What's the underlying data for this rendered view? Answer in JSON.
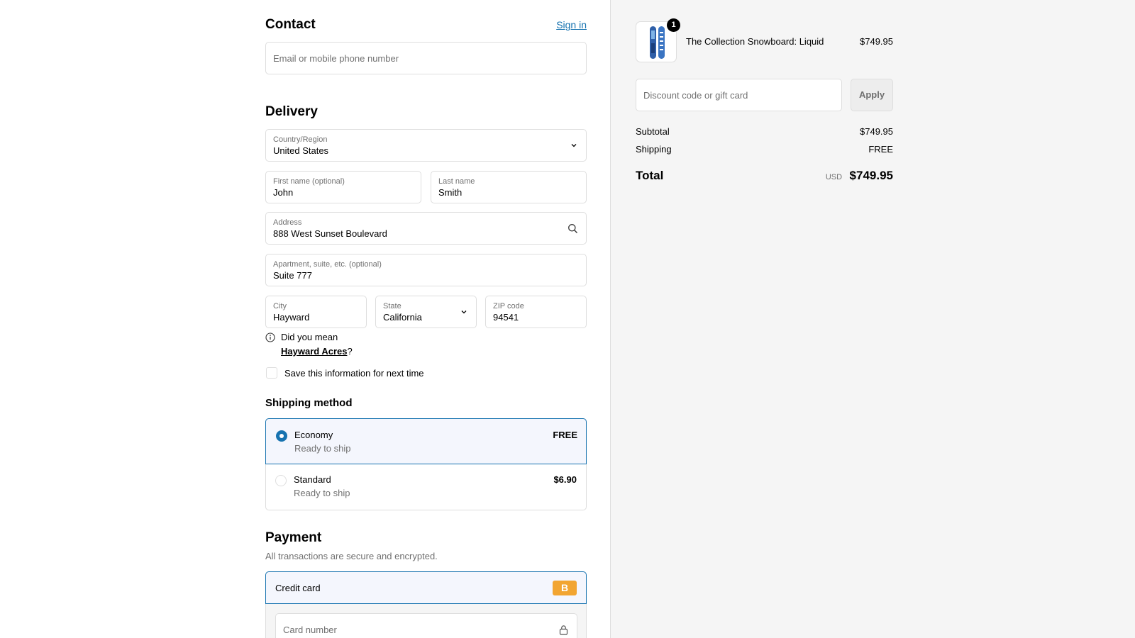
{
  "contact": {
    "title": "Contact",
    "sign_in": "Sign in",
    "email_placeholder": "Email or mobile phone number"
  },
  "delivery": {
    "title": "Delivery",
    "country_label": "Country/Region",
    "country_value": "United States",
    "first_name_label": "First name (optional)",
    "first_name_value": "John",
    "last_name_label": "Last name",
    "last_name_value": "Smith",
    "address_label": "Address",
    "address_value": "888 West Sunset Boulevard",
    "apt_label": "Apartment, suite, etc. (optional)",
    "apt_value": "Suite 777",
    "city_label": "City",
    "city_value": "Hayward",
    "state_label": "State",
    "state_value": "California",
    "zip_label": "ZIP code",
    "zip_value": "94541",
    "suggest_prefix": "Did you mean",
    "suggest_link": "Hayward Acres",
    "suggest_suffix": "?",
    "save_info": "Save this information for next time"
  },
  "shipping": {
    "title": "Shipping method",
    "options": [
      {
        "name": "Economy",
        "sub": "Ready to ship",
        "price": "FREE",
        "selected": true
      },
      {
        "name": "Standard",
        "sub": "Ready to ship",
        "price": "$6.90",
        "selected": false
      }
    ]
  },
  "payment": {
    "title": "Payment",
    "subtitle": "All transactions are secure and encrypted.",
    "method": "Credit card",
    "badge": "B",
    "card_placeholder": "Card number"
  },
  "summary": {
    "quantity": "1",
    "product_name": "The Collection Snowboard: Liquid",
    "product_price": "$749.95",
    "discount_placeholder": "Discount code or gift card",
    "apply": "Apply",
    "subtotal_label": "Subtotal",
    "subtotal_value": "$749.95",
    "shipping_label": "Shipping",
    "shipping_value": "FREE",
    "total_label": "Total",
    "currency": "USD",
    "total_value": "$749.95"
  },
  "colors": {
    "accent": "#1773b0",
    "badge": "#f2a531"
  }
}
